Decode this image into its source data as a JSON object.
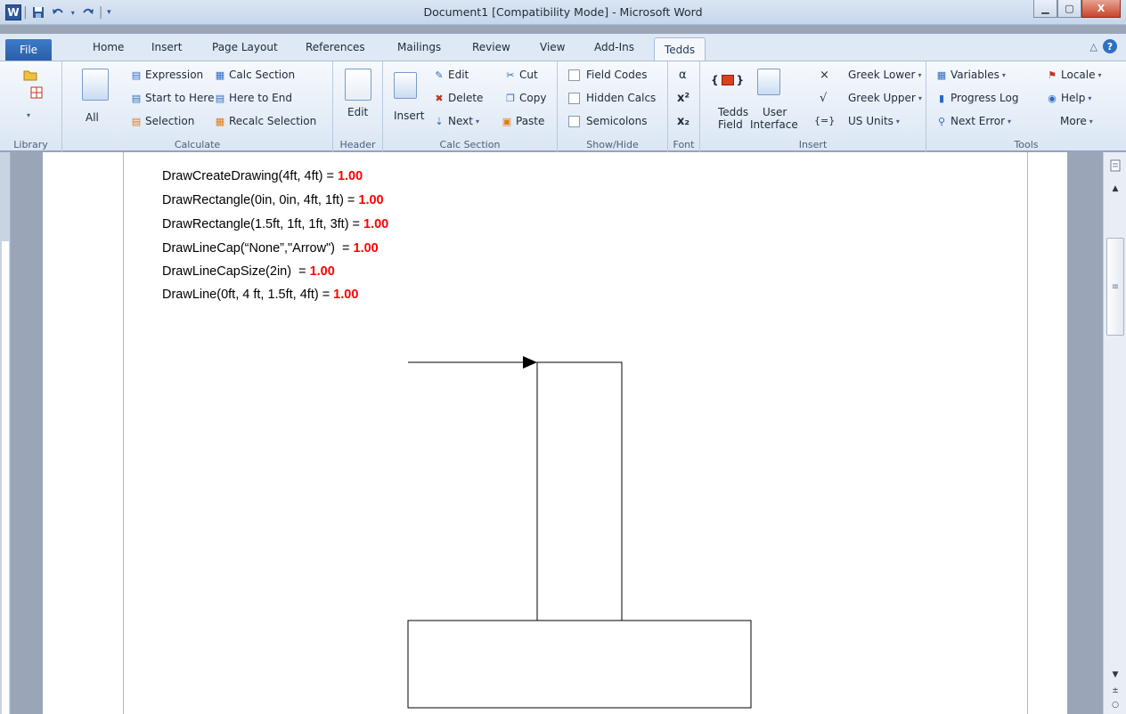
{
  "titlebar": {
    "title": "Document1 [Compatibility Mode] - Microsoft Word",
    "logo_letter": "W",
    "qat_separator": "|",
    "min_glyph": "▁",
    "max_glyph": "▢",
    "close_glyph": "X"
  },
  "tabs": {
    "file": "File",
    "home": "Home",
    "insert": "Insert",
    "page_layout": "Page Layout",
    "references": "References",
    "mailings": "Mailings",
    "review": "Review",
    "view": "View",
    "addins": "Add-Ins",
    "tedds": "Tedds",
    "help_glyph": "?",
    "minimize_ribbon_glyph": "△"
  },
  "ribbon": {
    "library": {
      "label": "Library"
    },
    "calculate": {
      "label": "Calculate",
      "all": "All",
      "expression": "Expression",
      "start_to_here": "Start to Here",
      "selection": "Selection",
      "calc_section": "Calc Section",
      "here_to_end": "Here to End",
      "recalc_selection": "Recalc Selection"
    },
    "header": {
      "label": "Header",
      "edit": "Edit"
    },
    "calc_section": {
      "label": "Calc Section",
      "insert": "Insert",
      "edit": "Edit",
      "delete": "Delete",
      "next": "Next",
      "cut": "Cut",
      "copy": "Copy",
      "paste": "Paste"
    },
    "show_hide": {
      "label": "Show/Hide",
      "field_codes": "Field Codes",
      "hidden_calcs": "Hidden Calcs",
      "semicolons": "Semicolons"
    },
    "font": {
      "label": "Font",
      "alpha": "α",
      "superscript": "x²",
      "subscript": "x₂"
    },
    "insert": {
      "label": "Insert",
      "tedds_field_1": "Tedds",
      "tedds_field_2": "Field",
      "user_interface_1": "User",
      "user_interface_2": "Interface",
      "times": "×",
      "sqrt": "√",
      "equals_field": "{=}",
      "greek_lower": "Greek Lower",
      "greek_upper": "Greek Upper",
      "us_units": "US Units"
    },
    "tools": {
      "label": "Tools",
      "variables": "Variables",
      "progress_log": "Progress Log",
      "next_error": "Next Error",
      "locale": "Locale",
      "help": "Help",
      "more": "More"
    }
  },
  "document": {
    "lines": [
      {
        "expr": "DrawCreateDrawing(4ft,  4ft)",
        "eq": "=",
        "result": "1.00"
      },
      {
        "expr": "DrawRectangle(0in,  0in, 4ft, 1ft)",
        "eq": "=",
        "result": "1.00"
      },
      {
        "expr": "DrawRectangle(1.5ft,  1ft, 1ft, 3ft)",
        "eq": "=",
        "result": "1.00"
      },
      {
        "expr": "DrawLineCap(“None”,\"Arrow\") ",
        "eq": "=",
        "result": "1.00"
      },
      {
        "expr": "DrawLineCapSize(2in) ",
        "eq": "=",
        "result": "1.00"
      },
      {
        "expr": "DrawLine(0ft, 4 ft, 1.5ft, 4ft)",
        "eq": "=",
        "result": "1.00"
      }
    ]
  },
  "colors": {
    "result_red": "#ff0000",
    "file_tab_blue": "#2a5ea9"
  }
}
